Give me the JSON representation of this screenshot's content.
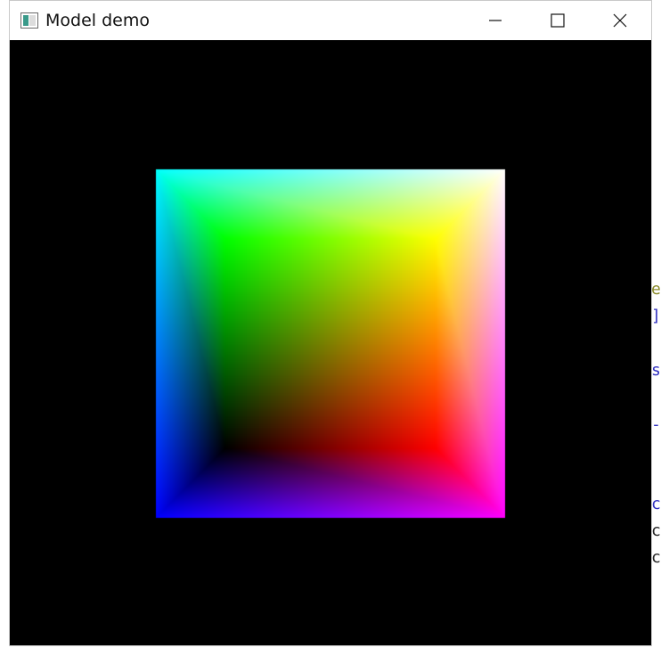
{
  "window": {
    "title": "Model demo",
    "icon": "app-window-icon",
    "controls": [
      {
        "name": "minimize",
        "icon": "minimize-icon"
      },
      {
        "name": "maximize",
        "icon": "maximize-icon"
      },
      {
        "name": "close",
        "icon": "close-icon"
      }
    ]
  },
  "scene": {
    "object": "cube",
    "vertex_colors": {
      "outer_top_left": "#00ffff",
      "outer_top_right": "#ffffff",
      "outer_bottom_left": "#0000ff",
      "outer_bottom_right": "#ff00ff",
      "inner_top_left": "#00ff00",
      "inner_top_right": "#ffff00",
      "inner_bottom_left": "#000000",
      "inner_bottom_right": "#ff0000"
    },
    "background": "#000000"
  },
  "background_fragments": [
    "e",
    "]",
    "s",
    "-",
    "c",
    "c",
    "c"
  ]
}
